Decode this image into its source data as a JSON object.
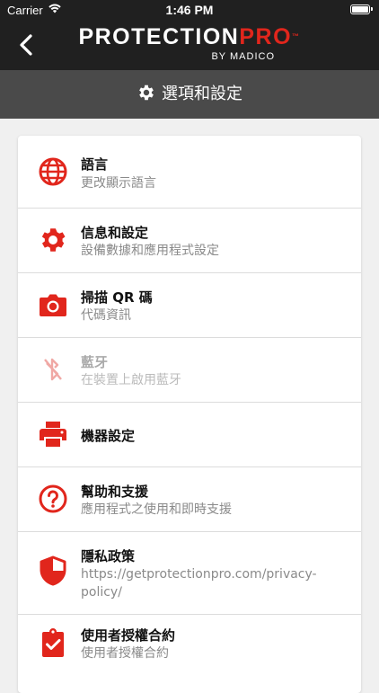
{
  "status_bar": {
    "carrier": "Carrier",
    "time": "1:46 PM"
  },
  "header": {
    "logo_main": "PROTECTION",
    "logo_pro": "PRO",
    "logo_sub": "BY MADICO",
    "logo_tm": "™"
  },
  "section": {
    "title": "選項和設定"
  },
  "menu": {
    "items": [
      {
        "title": "語言",
        "subtitle": "更改顯示語言",
        "icon": "globe-icon",
        "enabled": true
      },
      {
        "title": "信息和設定",
        "subtitle": "設備數據和應用程式設定",
        "icon": "gear-icon",
        "enabled": true
      },
      {
        "title": "掃描 QR 碼",
        "subtitle": "代碼資訊",
        "icon": "camera-icon",
        "enabled": true
      },
      {
        "title": "藍牙",
        "subtitle": "在裝置上啟用藍牙",
        "icon": "bluetooth-disabled-icon",
        "enabled": false
      },
      {
        "title": "機器設定",
        "subtitle": "",
        "icon": "printer-icon",
        "enabled": true
      },
      {
        "title": "幫助和支援",
        "subtitle": "應用程式之使用和即時支援",
        "icon": "help-icon",
        "enabled": true
      },
      {
        "title": "隱私政策",
        "subtitle": "https://getprotectionpro.com/privacy-policy/",
        "icon": "shield-icon",
        "enabled": true
      },
      {
        "title": "使用者授權合約",
        "subtitle": "使用者授權合約",
        "icon": "clipboard-check-icon",
        "enabled": true
      }
    ]
  },
  "colors": {
    "accent": "#e1261c",
    "nav_bg": "#202020",
    "section_bg": "#4a4a4a",
    "page_bg": "#f0f0f0"
  }
}
